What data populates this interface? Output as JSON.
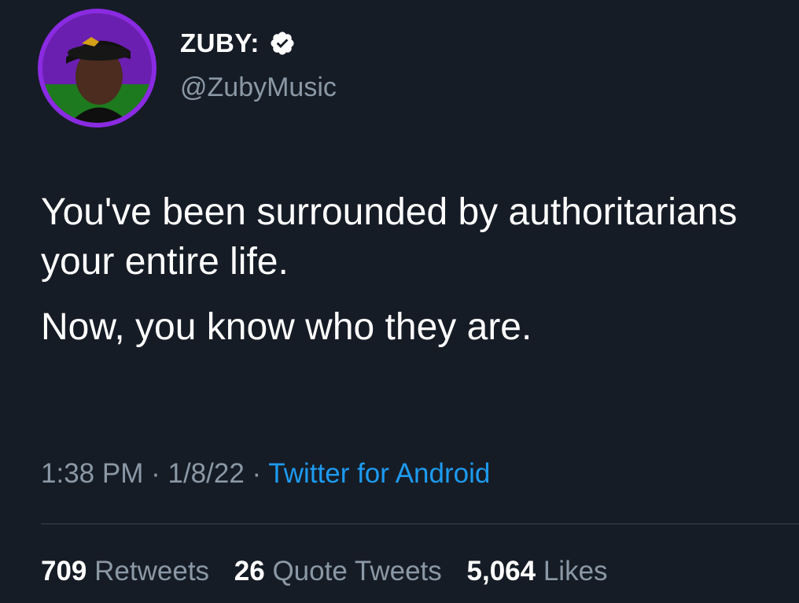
{
  "author": {
    "display_name": "ZUBY:",
    "handle": "@ZubyMusic",
    "verified_icon": "verified-badge-icon",
    "avatar_ring_color": "#8a2be2"
  },
  "tweet": {
    "paragraphs": [
      "You've been surrounded by authoritarians your entire life.",
      "Now, you know who they are."
    ],
    "time": "1:38 PM",
    "separator": "·",
    "date": "1/8/22",
    "source": "Twitter for Android"
  },
  "stats": {
    "retweets_count": "709",
    "retweets_label": "Retweets",
    "quotes_count": "26",
    "quotes_label": "Quote Tweets",
    "likes_count": "5,064",
    "likes_label": "Likes"
  },
  "colors": {
    "background": "#161c26",
    "primary_text": "#ffffff",
    "secondary_text": "#8b98a5",
    "link": "#1d9bf0",
    "divider": "#38444d"
  }
}
